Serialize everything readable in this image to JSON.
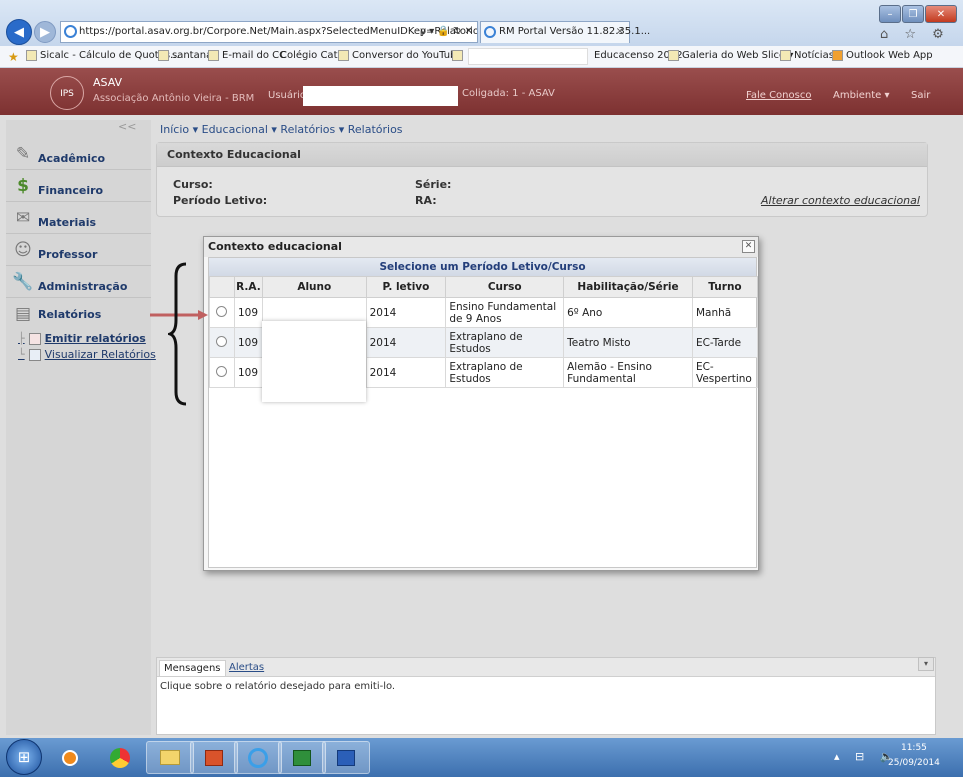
{
  "browser": {
    "url": "https://portal.asav.org.br/Corpore.Net/Main.aspx?SelectedMenuIDKey=RelatoriosEdu",
    "address_controls": "ρ ▾ 🔒 ↻ ✕",
    "tab_title": "RM Portal Versão 11.82.35.1...",
    "tab_close": "×",
    "window_min": "–",
    "window_max": "❐",
    "window_close": "✕",
    "tools": "⌂ ☆ ⚙"
  },
  "favorites": {
    "items": [
      "Sicalc - Cálculo de Quotas...",
      "santana",
      "E-mail do CC",
      "Colégio Cat...",
      "Conversor do YouTube",
      "Educacenso 2012",
      "Galeria do Web Slice ▾",
      "Notícias",
      "Outlook Web App"
    ]
  },
  "app": {
    "logo_text": "IPS",
    "name": "ASAV",
    "subtitle": "Associação Antônio Vieira - BRM",
    "user_label": "Usuário:",
    "coligada": "Coligada: 1 - ASAV",
    "fale_conosco": "Fale Conosco",
    "ambiente": "Ambiente ▾",
    "sair": "Sair"
  },
  "sidebar": {
    "collapse": "<<",
    "items": [
      {
        "label": "Acadêmico",
        "icon": "✎"
      },
      {
        "label": "Financeiro",
        "icon": "$"
      },
      {
        "label": "Materiais",
        "icon": "✉"
      },
      {
        "label": "Professor",
        "icon": "☺"
      },
      {
        "label": "Administração",
        "icon": "🔧"
      },
      {
        "label": "Relatórios",
        "icon": "▤"
      }
    ],
    "subitems": [
      "Emitir relatórios",
      "Visualizar Relatórios"
    ]
  },
  "breadcrumb": "Início ▾  Educacional ▾  Relatórios ▾  Relatórios",
  "context_panel": {
    "title": "Contexto Educacional",
    "curso_label": "Curso:",
    "periodo_label": "Período Letivo:",
    "serie_label": "Série:",
    "ra_label": "RA:",
    "alterar": "Alterar contexto educacional"
  },
  "modal": {
    "title": "Contexto educacional",
    "close": "✕",
    "grid_title": "Selecione um Período Letivo/Curso",
    "columns": [
      "",
      "R.A.",
      "Aluno",
      "P. letivo",
      "Curso",
      "Habilitação/Série",
      "Turno"
    ],
    "rows": [
      {
        "ra": "109",
        "aluno": "",
        "periodo": "2014",
        "curso": "Ensino Fundamental de 9 Anos",
        "habilitacao": "6º Ano",
        "turno": "Manhã"
      },
      {
        "ra": "109",
        "aluno": "",
        "periodo": "2014",
        "curso": "Extraplano de Estudos",
        "habilitacao": "Teatro Misto",
        "turno": "EC-Tarde"
      },
      {
        "ra": "109",
        "aluno": "",
        "periodo": "2014",
        "curso": "Extraplano de Estudos",
        "habilitacao": "Alemão - Ensino Fundamental",
        "turno": "EC-Vespertino"
      }
    ]
  },
  "bottom_panel": {
    "tab_mensagens": "Mensagens",
    "tab_alertas": "Alertas",
    "message": "Clique sobre o relatório desejado para emiti-lo.",
    "toggle": "▾"
  },
  "taskbar": {
    "start": "⊞",
    "time": "11:55",
    "date": "25/09/2014",
    "tray": "▴ ⊟ 🔈"
  },
  "colors": {
    "header_brand": "#8a3c3b",
    "link_blue": "#1f3a6b",
    "grid_title": "#233e7a"
  }
}
